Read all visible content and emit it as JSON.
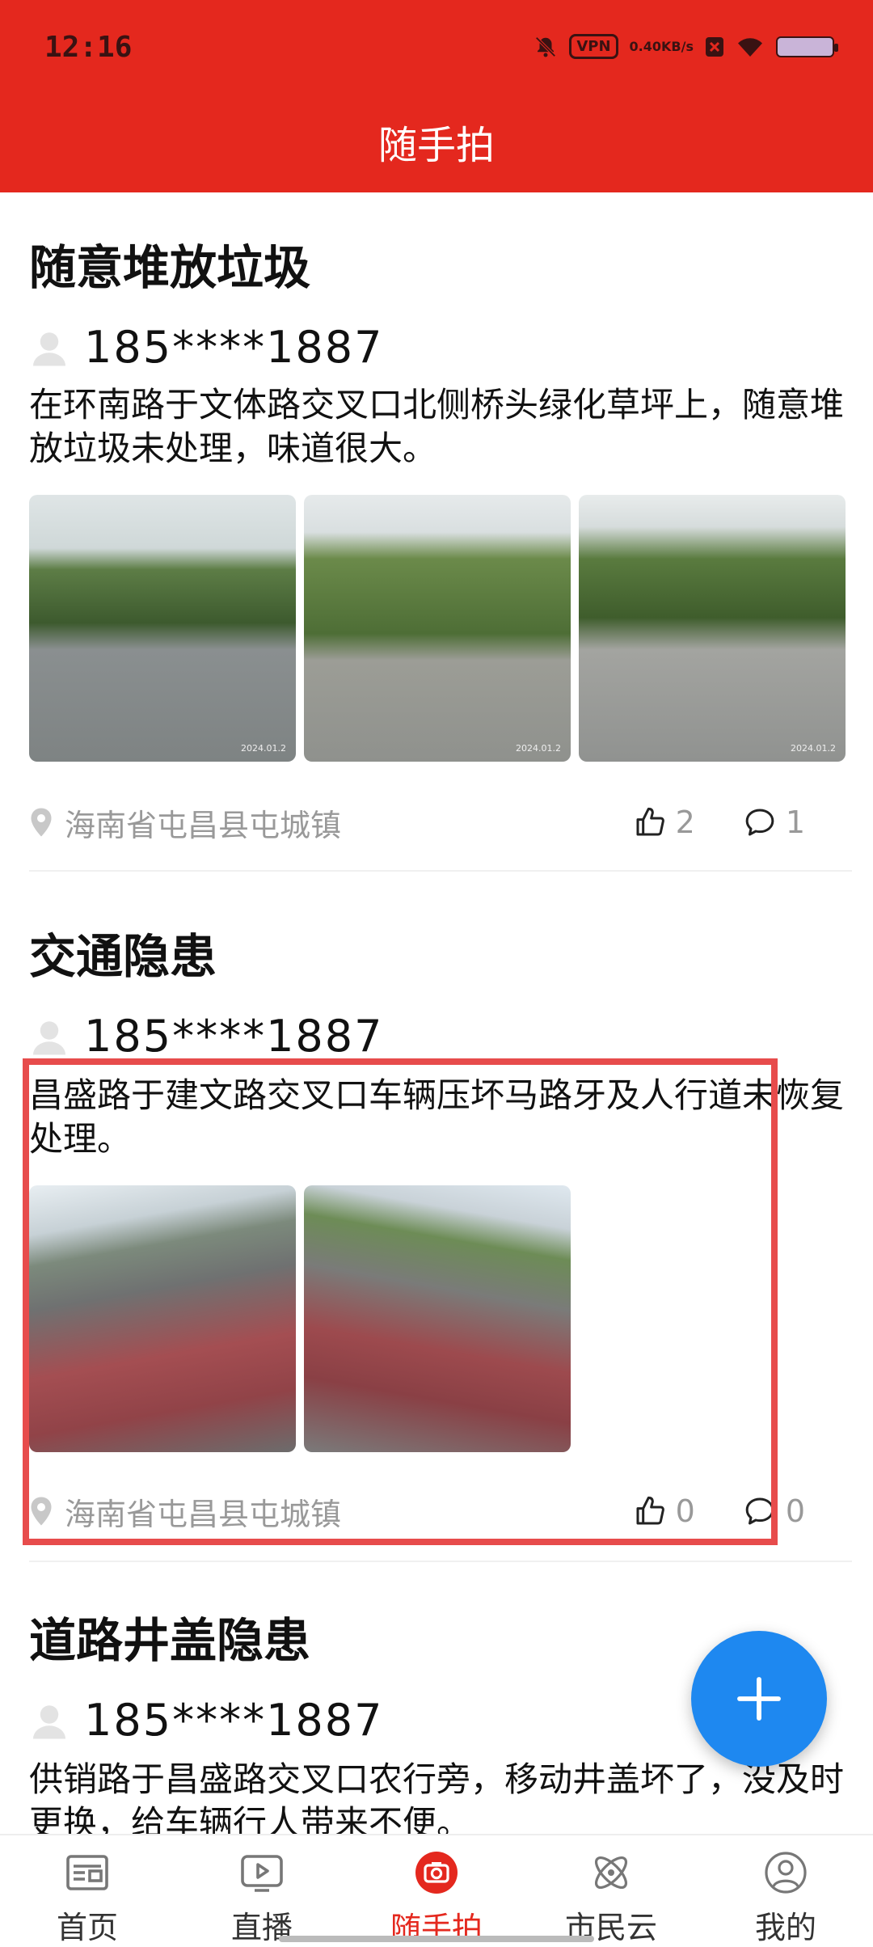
{
  "status_bar": {
    "time": "12:16",
    "vpn": "VPN",
    "speed_value": "0.40",
    "speed_unit": "KB/s"
  },
  "header": {
    "title": "随手拍"
  },
  "posts": [
    {
      "title": "随意堆放垃圾",
      "user": "185****1887",
      "content": "在环南路于文体路交叉口北侧桥头绿化草坪上，随意堆放垃圾未处理，味道很大。",
      "image_stamps": [
        "2024.01.2",
        "2024.01.2",
        "2024.01.2"
      ],
      "location": "海南省屯昌县屯城镇",
      "likes": "2",
      "comments": "1"
    },
    {
      "title": "交通隐患",
      "user": "185****1887",
      "content": "昌盛路于建文路交叉口车辆压坏马路牙及人行道未恢复处理。",
      "image_stamps": [
        "",
        ""
      ],
      "location": "海南省屯昌县屯城镇",
      "likes": "0",
      "comments": "0"
    },
    {
      "title": "道路井盖隐患",
      "user": "185****1887",
      "content": "供销路于昌盛路交叉口农行旁，移动井盖坏了，没及时更换，给车辆行人带来不便。"
    }
  ],
  "nav": {
    "items": [
      {
        "label": "首页",
        "icon": "news-icon"
      },
      {
        "label": "直播",
        "icon": "live-play-icon"
      },
      {
        "label": "随手拍",
        "icon": "camera-icon"
      },
      {
        "label": "市民云",
        "icon": "planet-icon"
      },
      {
        "label": "我的",
        "icon": "user-profile-icon"
      }
    ],
    "active_index": 2
  },
  "colors": {
    "brand_red": "#e4281e",
    "fab_blue": "#1e88f0",
    "highlight_red": "#e74c4c",
    "muted_gray": "#999999"
  }
}
